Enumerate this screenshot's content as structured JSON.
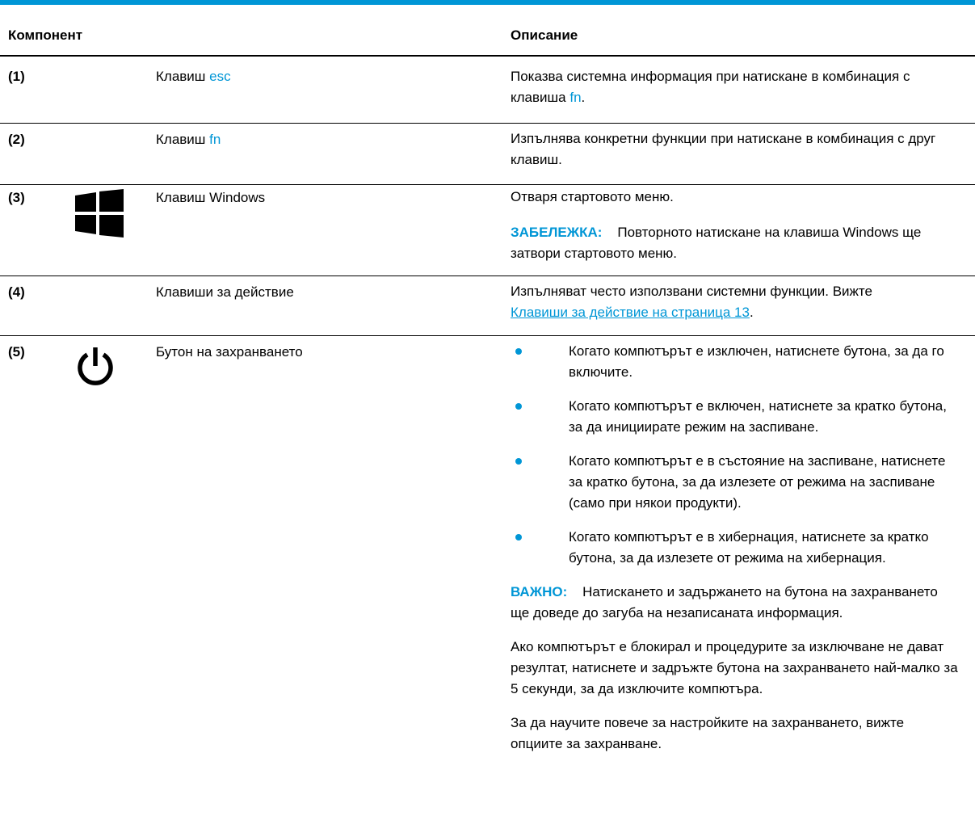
{
  "header": {
    "col_component": "Компонент",
    "col_description": "Описание"
  },
  "rows": [
    {
      "number": "(1)",
      "component_prefix": "Клавиш ",
      "component_key": "esc",
      "description_prefix": "Показва системна информация при натискане в комбинация с клавиша ",
      "description_key": "fn",
      "description_suffix": "."
    },
    {
      "number": "(2)",
      "component_prefix": "Клавиш ",
      "component_key": "fn",
      "description": "Изпълнява конкретни функции при натискане в комбинация с друг клавиш."
    },
    {
      "number": "(3)",
      "icon": "windows-logo-icon",
      "component": "Клавиш Windows",
      "description": "Отваря стартовото меню.",
      "note_label": "ЗАБЕЛЕЖКА:",
      "note_text": "Повторното натискане на клавиша Windows ще затвори стартовото меню."
    },
    {
      "number": "(4)",
      "component": "Клавиши за действие",
      "description": "Изпълняват често използвани системни функции. Вижте",
      "link_text": "Клавиши за действие на страница 13",
      "link_suffix": "."
    },
    {
      "number": "(5)",
      "icon": "power-icon",
      "component": "Бутон на захранването",
      "bullets": [
        "Когато компютърът е изключен, натиснете бутона, за да го включите.",
        "Когато компютърът е включен, натиснете за кратко бутона, за да инициирате режим на заспиване.",
        "Когато компютърът е в състояние на заспиване, натиснете за кратко бутона, за да излезете от режима на заспиване (само при някои продукти).",
        "Когато компютърът е в хибернация, натиснете за кратко бутона, за да излезете от режима на хибернация."
      ],
      "important_label": "ВАЖНО:",
      "important_text": "Натискането и задържането на бутона на захранването ще доведе до загуба на незаписаната информация.",
      "paragraph_1": "Ако компютърът е блокирал и процедурите за изключване не дават резултат, натиснете и задръжте бутона на захранването най-малко за 5 секунди, за да изключите компютъра.",
      "paragraph_2": "За да научите повече за настройките на захранването, вижте опциите за захранване."
    }
  ],
  "colors": {
    "accent": "#0096d6",
    "text": "#000000",
    "background": "#ffffff"
  }
}
